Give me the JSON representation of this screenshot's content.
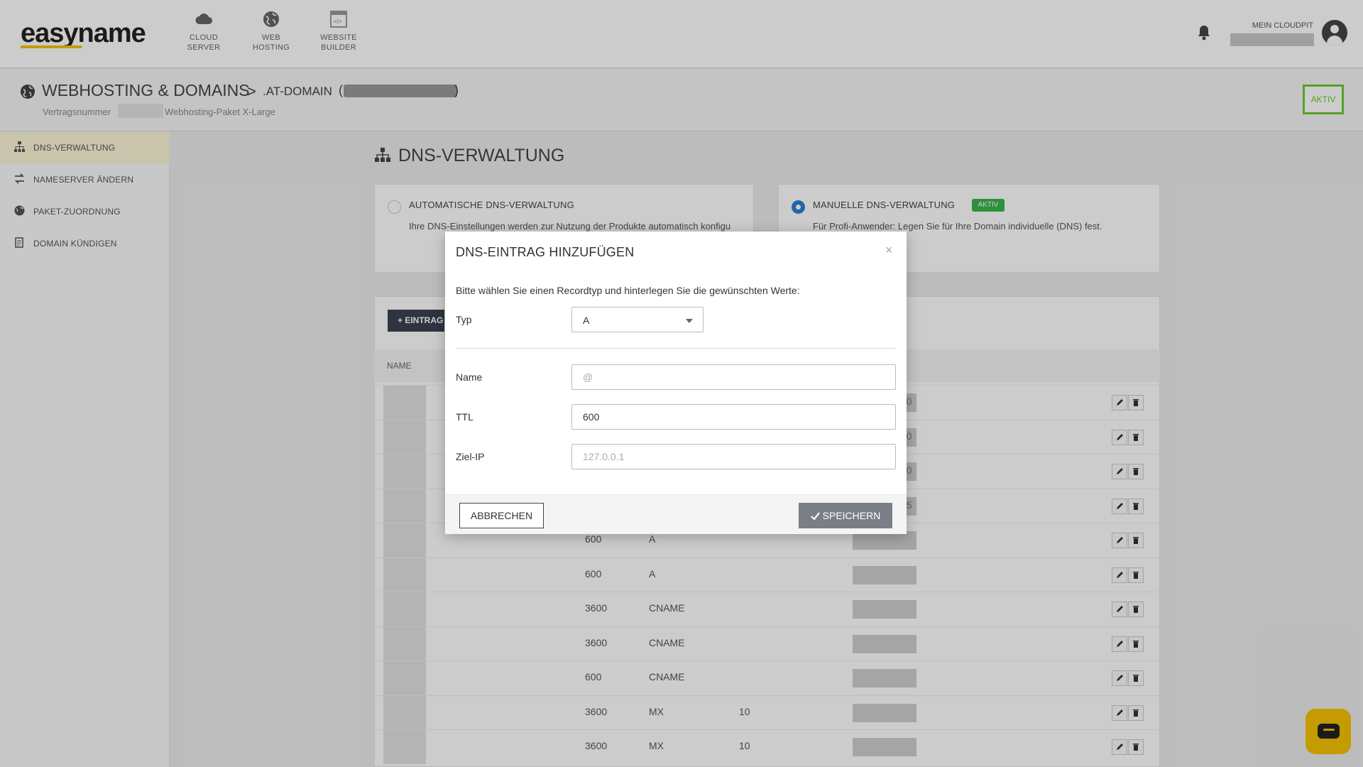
{
  "header": {
    "logo": "easyname",
    "nav": [
      {
        "line1": "CLOUD",
        "line2": "SERVER",
        "icon": "cloud-icon"
      },
      {
        "line1": "WEB",
        "line2": "HOSTING",
        "icon": "globe-icon"
      },
      {
        "line1": "WEBSITE",
        "line2": "BUILDER",
        "icon": "website-builder-icon"
      }
    ],
    "account_label": "MEIN CLOUDPIT"
  },
  "breadcrumb": {
    "main": "WEBHOSTING & DOMAINS",
    "separator": ">",
    "sub": ".AT-DOMAIN",
    "paren_open": "(",
    "paren_close": ")",
    "contract_label": "Vertragsnummer",
    "package": "Webhosting-Paket X-Large",
    "status": "AKTIV"
  },
  "sidebar": {
    "items": [
      {
        "label": "DNS-VERWALTUNG",
        "icon": "sitemap-icon",
        "active": true
      },
      {
        "label": "NAMESERVER ÄNDERN",
        "icon": "exchange-icon",
        "active": false
      },
      {
        "label": "PAKET-ZUORDNUNG",
        "icon": "globe-icon",
        "active": false
      },
      {
        "label": "DOMAIN KÜNDIGEN",
        "icon": "document-icon",
        "active": false
      }
    ]
  },
  "main": {
    "title": "DNS-VERWALTUNG",
    "options": [
      {
        "title": "AUTOMATISCHE DNS-VERWALTUNG",
        "desc": "Ihre DNS-Einstellungen werden zur Nutzung der Produkte automatisch konfigu",
        "selected": false
      },
      {
        "title": "MANUELLE DNS-VERWALTUNG",
        "badge": "AKTIV",
        "desc": "Für Profi-Anwender: Legen Sie für Ihre Domain individuelle (DNS) fest.",
        "selected": true
      }
    ],
    "add_button": "+ EINTRAG",
    "table_header_name": "NAME",
    "rows": [
      {
        "ttl": "",
        "type": "",
        "prio": "",
        "tail": "30"
      },
      {
        "ttl": "",
        "type": "",
        "prio": "",
        "tail": "30"
      },
      {
        "ttl": "",
        "type": "",
        "prio": "",
        "tail": "30"
      },
      {
        "ttl": "",
        "type": "",
        "prio": "",
        "tail": "35"
      },
      {
        "ttl": "600",
        "type": "A",
        "prio": "",
        "tail": ""
      },
      {
        "ttl": "600",
        "type": "A",
        "prio": "",
        "tail": ""
      },
      {
        "ttl": "3600",
        "type": "CNAME",
        "prio": "",
        "tail": ""
      },
      {
        "ttl": "3600",
        "type": "CNAME",
        "prio": "",
        "tail": ""
      },
      {
        "ttl": "600",
        "type": "CNAME",
        "prio": "",
        "tail": ""
      },
      {
        "ttl": "3600",
        "type": "MX",
        "prio": "10",
        "tail": ""
      },
      {
        "ttl": "3600",
        "type": "MX",
        "prio": "10",
        "tail": ""
      }
    ]
  },
  "modal": {
    "title": "DNS-EINTRAG HINZUFÜGEN",
    "close": "×",
    "intro": "Bitte wählen Sie einen Recordtyp und hinterlegen Sie die gewünschten Werte:",
    "type_label": "Typ",
    "type_value": "A",
    "name_label": "Name",
    "name_placeholder": "@",
    "ttl_label": "TTL",
    "ttl_value": "600",
    "target_label": "Ziel-IP",
    "target_placeholder": "127.0.0.1",
    "cancel": "ABBRECHEN",
    "save": "SPEICHERN"
  },
  "colors": {
    "accent_yellow": "#f6c200",
    "status_green": "#6fca2c",
    "badge_green": "#39b54a",
    "radio_blue": "#2a7ed2",
    "save_button": "#7a7f86"
  }
}
